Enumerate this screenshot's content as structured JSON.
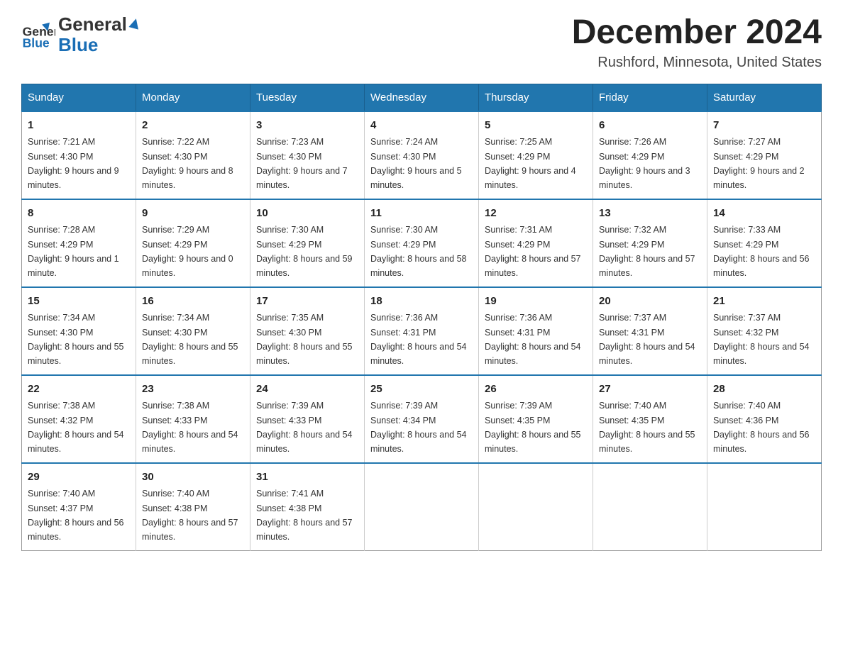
{
  "header": {
    "logo_general": "General",
    "logo_blue": "Blue",
    "month_title": "December 2024",
    "location": "Rushford, Minnesota, United States"
  },
  "weekdays": [
    "Sunday",
    "Monday",
    "Tuesday",
    "Wednesday",
    "Thursday",
    "Friday",
    "Saturday"
  ],
  "weeks": [
    [
      {
        "day": "1",
        "sunrise": "7:21 AM",
        "sunset": "4:30 PM",
        "daylight": "9 hours and 9 minutes."
      },
      {
        "day": "2",
        "sunrise": "7:22 AM",
        "sunset": "4:30 PM",
        "daylight": "9 hours and 8 minutes."
      },
      {
        "day": "3",
        "sunrise": "7:23 AM",
        "sunset": "4:30 PM",
        "daylight": "9 hours and 7 minutes."
      },
      {
        "day": "4",
        "sunrise": "7:24 AM",
        "sunset": "4:30 PM",
        "daylight": "9 hours and 5 minutes."
      },
      {
        "day": "5",
        "sunrise": "7:25 AM",
        "sunset": "4:29 PM",
        "daylight": "9 hours and 4 minutes."
      },
      {
        "day": "6",
        "sunrise": "7:26 AM",
        "sunset": "4:29 PM",
        "daylight": "9 hours and 3 minutes."
      },
      {
        "day": "7",
        "sunrise": "7:27 AM",
        "sunset": "4:29 PM",
        "daylight": "9 hours and 2 minutes."
      }
    ],
    [
      {
        "day": "8",
        "sunrise": "7:28 AM",
        "sunset": "4:29 PM",
        "daylight": "9 hours and 1 minute."
      },
      {
        "day": "9",
        "sunrise": "7:29 AM",
        "sunset": "4:29 PM",
        "daylight": "9 hours and 0 minutes."
      },
      {
        "day": "10",
        "sunrise": "7:30 AM",
        "sunset": "4:29 PM",
        "daylight": "8 hours and 59 minutes."
      },
      {
        "day": "11",
        "sunrise": "7:30 AM",
        "sunset": "4:29 PM",
        "daylight": "8 hours and 58 minutes."
      },
      {
        "day": "12",
        "sunrise": "7:31 AM",
        "sunset": "4:29 PM",
        "daylight": "8 hours and 57 minutes."
      },
      {
        "day": "13",
        "sunrise": "7:32 AM",
        "sunset": "4:29 PM",
        "daylight": "8 hours and 57 minutes."
      },
      {
        "day": "14",
        "sunrise": "7:33 AM",
        "sunset": "4:29 PM",
        "daylight": "8 hours and 56 minutes."
      }
    ],
    [
      {
        "day": "15",
        "sunrise": "7:34 AM",
        "sunset": "4:30 PM",
        "daylight": "8 hours and 55 minutes."
      },
      {
        "day": "16",
        "sunrise": "7:34 AM",
        "sunset": "4:30 PM",
        "daylight": "8 hours and 55 minutes."
      },
      {
        "day": "17",
        "sunrise": "7:35 AM",
        "sunset": "4:30 PM",
        "daylight": "8 hours and 55 minutes."
      },
      {
        "day": "18",
        "sunrise": "7:36 AM",
        "sunset": "4:31 PM",
        "daylight": "8 hours and 54 minutes."
      },
      {
        "day": "19",
        "sunrise": "7:36 AM",
        "sunset": "4:31 PM",
        "daylight": "8 hours and 54 minutes."
      },
      {
        "day": "20",
        "sunrise": "7:37 AM",
        "sunset": "4:31 PM",
        "daylight": "8 hours and 54 minutes."
      },
      {
        "day": "21",
        "sunrise": "7:37 AM",
        "sunset": "4:32 PM",
        "daylight": "8 hours and 54 minutes."
      }
    ],
    [
      {
        "day": "22",
        "sunrise": "7:38 AM",
        "sunset": "4:32 PM",
        "daylight": "8 hours and 54 minutes."
      },
      {
        "day": "23",
        "sunrise": "7:38 AM",
        "sunset": "4:33 PM",
        "daylight": "8 hours and 54 minutes."
      },
      {
        "day": "24",
        "sunrise": "7:39 AM",
        "sunset": "4:33 PM",
        "daylight": "8 hours and 54 minutes."
      },
      {
        "day": "25",
        "sunrise": "7:39 AM",
        "sunset": "4:34 PM",
        "daylight": "8 hours and 54 minutes."
      },
      {
        "day": "26",
        "sunrise": "7:39 AM",
        "sunset": "4:35 PM",
        "daylight": "8 hours and 55 minutes."
      },
      {
        "day": "27",
        "sunrise": "7:40 AM",
        "sunset": "4:35 PM",
        "daylight": "8 hours and 55 minutes."
      },
      {
        "day": "28",
        "sunrise": "7:40 AM",
        "sunset": "4:36 PM",
        "daylight": "8 hours and 56 minutes."
      }
    ],
    [
      {
        "day": "29",
        "sunrise": "7:40 AM",
        "sunset": "4:37 PM",
        "daylight": "8 hours and 56 minutes."
      },
      {
        "day": "30",
        "sunrise": "7:40 AM",
        "sunset": "4:38 PM",
        "daylight": "8 hours and 57 minutes."
      },
      {
        "day": "31",
        "sunrise": "7:41 AM",
        "sunset": "4:38 PM",
        "daylight": "8 hours and 57 minutes."
      },
      null,
      null,
      null,
      null
    ]
  ],
  "labels": {
    "sunrise": "Sunrise:",
    "sunset": "Sunset:",
    "daylight": "Daylight:"
  }
}
